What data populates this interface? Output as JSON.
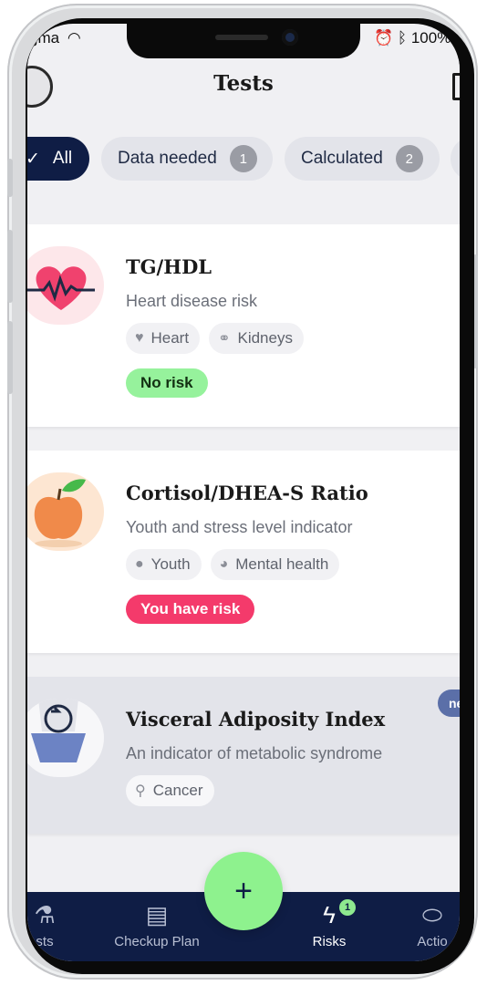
{
  "status_bar": {
    "carrier": "gma",
    "battery": "100%"
  },
  "header": {
    "title": "Tests"
  },
  "filters": [
    {
      "label": "All",
      "count": "",
      "active": true
    },
    {
      "label": "Data needed",
      "count": "1",
      "active": false
    },
    {
      "label": "Calculated",
      "count": "2",
      "active": false
    }
  ],
  "cards": [
    {
      "title": "TG/HDL",
      "subtitle": "Heart disease risk",
      "tags": [
        "Heart",
        "Kidneys"
      ],
      "status": "No risk",
      "icon": "heart-rate-icon"
    },
    {
      "title": "Cortisol/DHEA-S Ratio",
      "subtitle": "Youth and stress level indicator",
      "tags": [
        "Youth",
        "Mental health"
      ],
      "status": "You have risk",
      "icon": "apple-icon"
    },
    {
      "title": "Visceral Adiposity Index",
      "subtitle": "An indicator of metabolic syndrome",
      "tags": [
        "Cancer"
      ],
      "status": "",
      "corner_badge": "ne",
      "icon": "body-icon"
    }
  ],
  "tabbar": {
    "tests": "sts",
    "checkup": "Checkup Plan",
    "risks": "Risks",
    "risks_badge": "1",
    "actions": "Actio"
  },
  "fab_label": "+",
  "colors": {
    "navy": "#0f1d45",
    "green": "#96f29c",
    "risk": "#f43a6b"
  }
}
